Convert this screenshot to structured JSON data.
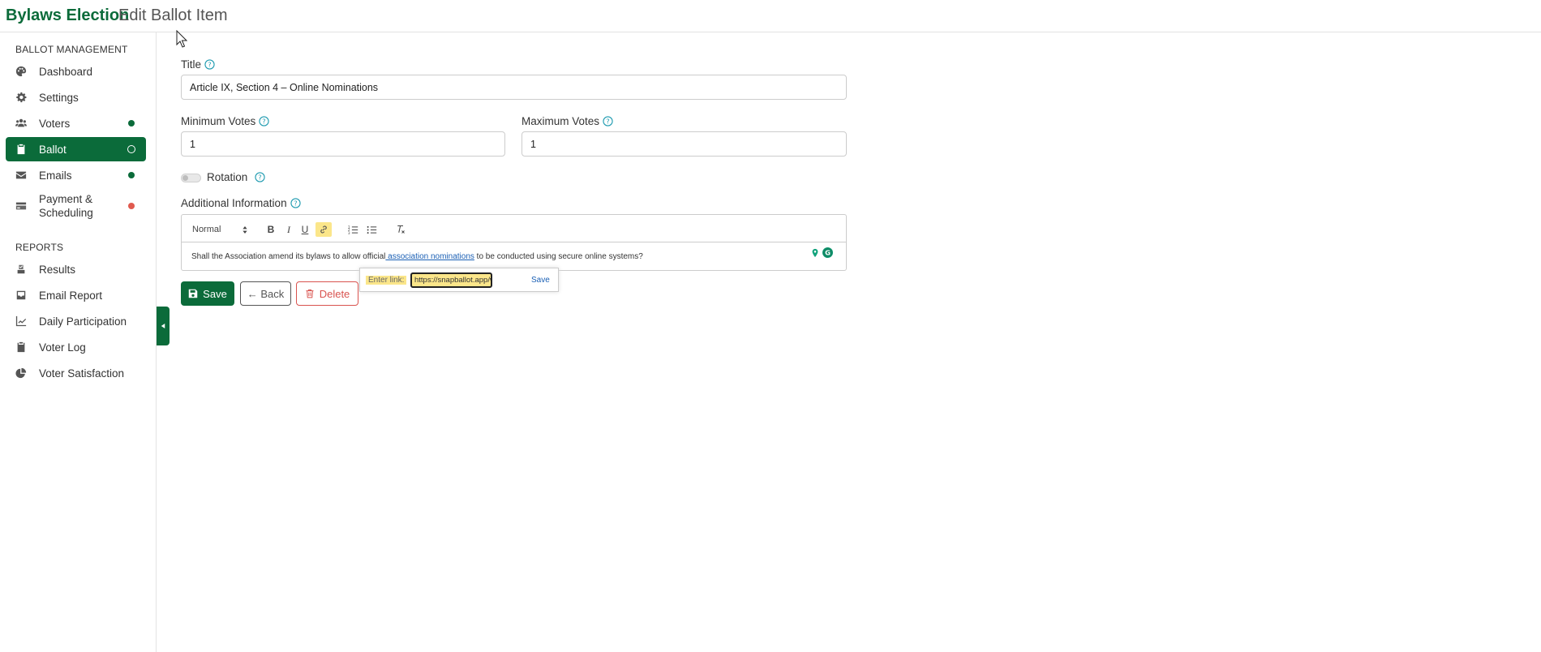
{
  "header": {
    "brand": "Bylaws Election",
    "subtitle": "Edit Ballot Item"
  },
  "sidebar": {
    "section_management": "BALLOT MANAGEMENT",
    "section_reports": "REPORTS",
    "items": [
      {
        "label": "Dashboard",
        "icon": "palette-icon"
      },
      {
        "label": "Settings",
        "icon": "gear-icon"
      },
      {
        "label": "Voters",
        "icon": "users-icon",
        "status": "green"
      },
      {
        "label": "Ballot",
        "icon": "clipboard-icon",
        "status": "active"
      },
      {
        "label": "Emails",
        "icon": "envelope-icon",
        "status": "green"
      },
      {
        "label": "Payment &",
        "label2": "Scheduling",
        "icon": "credit-card-icon",
        "status": "red"
      }
    ],
    "reports": [
      {
        "label": "Results",
        "icon": "vote-icon"
      },
      {
        "label": "Email Report",
        "icon": "inbox-icon"
      },
      {
        "label": "Daily Participation",
        "icon": "chart-icon"
      },
      {
        "label": "Voter Log",
        "icon": "clipboard-icon"
      },
      {
        "label": "Voter Satisfaction",
        "icon": "pie-chart-icon"
      }
    ]
  },
  "form": {
    "title_label": "Title",
    "title_value": "Article IX, Section 4 – Online Nominations",
    "min_label": "Minimum Votes",
    "min_value": "1",
    "max_label": "Maximum Votes",
    "max_value": "1",
    "rotation_label": "Rotation",
    "rotation_on": false,
    "info_label": "Additional Information",
    "editor": {
      "format_select": "Normal",
      "text_before": "Shall the Association amend its bylaws to allow official",
      "link_text": " association nominations",
      "text_after": " to be conducted using secure online systems?"
    },
    "link_tooltip": {
      "label": "Enter link:",
      "value": "https://snapballot.app/who-",
      "save": "Save"
    }
  },
  "actions": {
    "save": "Save",
    "back": "← Back",
    "delete": "Delete"
  },
  "colors": {
    "brand": "#0b6b3a",
    "danger": "#d9534f",
    "status_red": "#e05a4f",
    "help": "#1f9bb0"
  }
}
